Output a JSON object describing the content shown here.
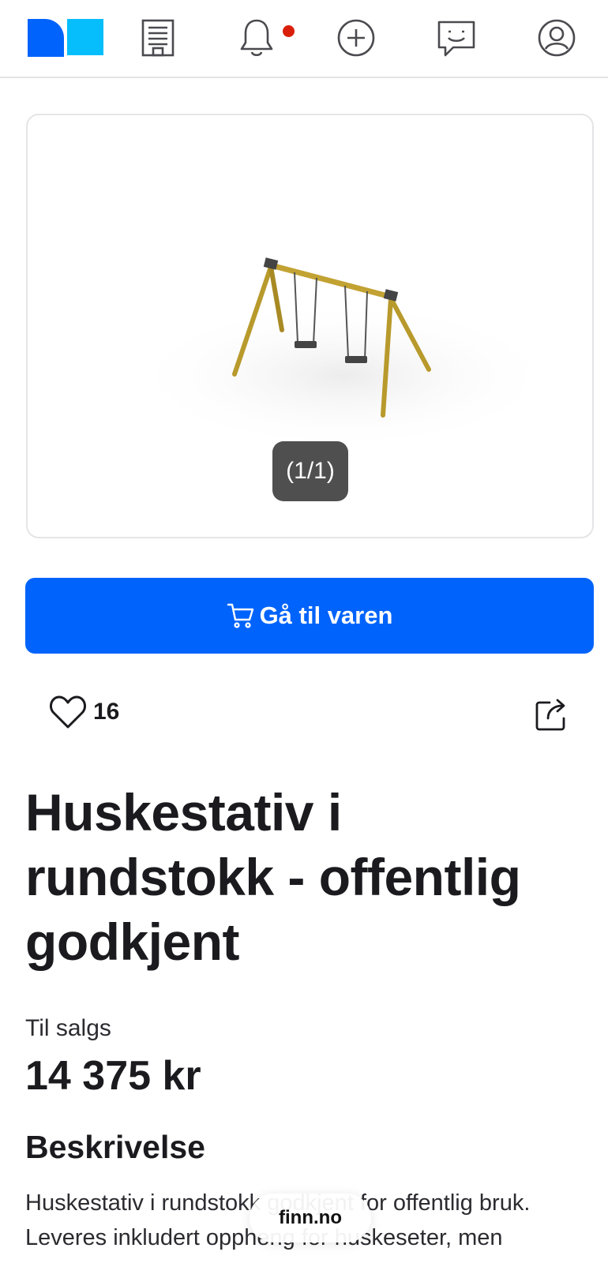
{
  "colors": {
    "primary": "#0063fb",
    "logo_dark": "#0063fb",
    "logo_light": "#06befb",
    "notification_dot": "#d91f0a"
  },
  "nav": {
    "icons": [
      "finn-logo",
      "building-icon",
      "bell-icon",
      "plus-circle-icon",
      "chat-icon",
      "profile-icon"
    ],
    "has_notification": true
  },
  "gallery": {
    "counter": "(1/1)"
  },
  "cta": {
    "label": "Gå til varen",
    "icon": "cart-icon"
  },
  "favorites": {
    "count": "16"
  },
  "listing": {
    "title": "Huskestativ i rundstokk - offentlig godkjent",
    "status": "Til salgs",
    "price": "14 375 kr"
  },
  "description": {
    "heading": "Beskrivelse",
    "text": "Huskestativ i rundstokk godkjent for offentlig bruk. Leveres inkludert oppheng for huskeseter, men"
  },
  "browser": {
    "url": "finn.no"
  }
}
